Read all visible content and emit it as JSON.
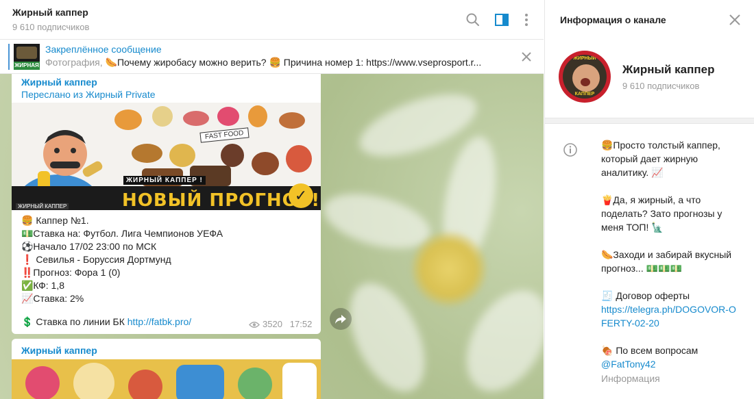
{
  "header": {
    "title": "Жирный каппер",
    "subscribers": "9 610 подписчиков"
  },
  "pinned": {
    "title": "Закреплённое сообщение",
    "thumb_label": "ЖИРНАЯ",
    "prefix": "Фотография, ",
    "text": "🌭Почему жиробасу можно верить? 🍔 Причина номер 1: https://www.vseprosport.r..."
  },
  "message1": {
    "from": "Жирный каппер",
    "forwarded": "Переслано из Жирный Private",
    "banner": {
      "headline": "НОВЫЙ ПРОГНОЗ!",
      "small_label": "ЖИРНЫЙ КАППЕР !",
      "fast_food": "FAST FOOD",
      "logo": "ЖИРНЫЙ КАППЕР"
    },
    "lines": [
      "🍔 Каппер №1.",
      "💵Ставка на: Футбол. Лига Чемпионов УЕФА",
      "⚽Начало 17/02 23:00 по МСК",
      "❗ Севилья - Боруссия Дортмунд",
      "‼️Прогноз: Фора 1 (0)",
      "✅КФ: 1,8",
      "📈Ставка: 2%"
    ],
    "footer_prefix": "💲 Ставка по линии БК ",
    "footer_link": "http://fatbk.pro/",
    "views": "3520",
    "time": "17:52"
  },
  "message2": {
    "from": "Жирный каппер"
  },
  "sidebar": {
    "title": "Информация о канале",
    "name": "Жирный каппер",
    "subscribers": "9 610 подписчиков",
    "avatar_top": "ЖИРНЫЙ",
    "avatar_bottom": "КАППЕР",
    "desc1": "🍔Просто толстый каппер, который дает жирную аналитику. 📈",
    "desc2": "🍟Да, я жирный, а что поделать? Зато прогнозы у меня ТОП! 🗽",
    "desc3": "🌭Заходи и забирай вкусный прогноз... 💵💵💵",
    "desc4_prefix": "🧾 Договор оферты",
    "desc4_link": "https://telegra.ph/DOGOVOR-OFERTY-02-20",
    "desc5_prefix": "🍖 По всем вопросам",
    "desc5_link": "@FatTony42",
    "label": "Информация"
  },
  "colors": {
    "accent": "#168acd",
    "muted": "#999999",
    "banner_yellow": "#f2c227"
  },
  "icons": [
    "search-icon",
    "sidebar-toggle-icon",
    "more-icon",
    "close-icon",
    "eye-icon",
    "share-icon",
    "info-icon"
  ]
}
